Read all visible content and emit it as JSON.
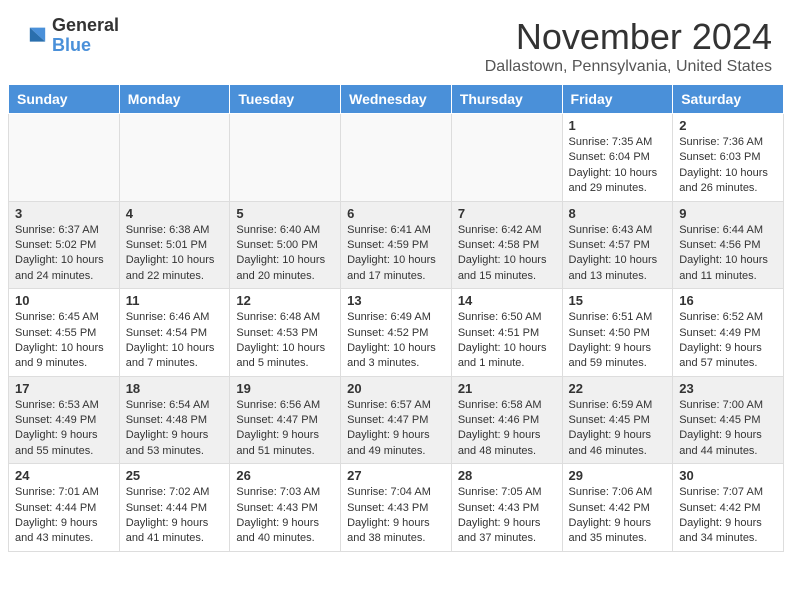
{
  "header": {
    "logo": {
      "general": "General",
      "blue": "Blue"
    },
    "title": "November 2024",
    "location": "Dallastown, Pennsylvania, United States"
  },
  "calendar": {
    "days_of_week": [
      "Sunday",
      "Monday",
      "Tuesday",
      "Wednesday",
      "Thursday",
      "Friday",
      "Saturday"
    ],
    "weeks": [
      [
        {
          "day": "",
          "info": ""
        },
        {
          "day": "",
          "info": ""
        },
        {
          "day": "",
          "info": ""
        },
        {
          "day": "",
          "info": ""
        },
        {
          "day": "",
          "info": ""
        },
        {
          "day": "1",
          "info": "Sunrise: 7:35 AM\nSunset: 6:04 PM\nDaylight: 10 hours and 29 minutes."
        },
        {
          "day": "2",
          "info": "Sunrise: 7:36 AM\nSunset: 6:03 PM\nDaylight: 10 hours and 26 minutes."
        }
      ],
      [
        {
          "day": "3",
          "info": "Sunrise: 6:37 AM\nSunset: 5:02 PM\nDaylight: 10 hours and 24 minutes."
        },
        {
          "day": "4",
          "info": "Sunrise: 6:38 AM\nSunset: 5:01 PM\nDaylight: 10 hours and 22 minutes."
        },
        {
          "day": "5",
          "info": "Sunrise: 6:40 AM\nSunset: 5:00 PM\nDaylight: 10 hours and 20 minutes."
        },
        {
          "day": "6",
          "info": "Sunrise: 6:41 AM\nSunset: 4:59 PM\nDaylight: 10 hours and 17 minutes."
        },
        {
          "day": "7",
          "info": "Sunrise: 6:42 AM\nSunset: 4:58 PM\nDaylight: 10 hours and 15 minutes."
        },
        {
          "day": "8",
          "info": "Sunrise: 6:43 AM\nSunset: 4:57 PM\nDaylight: 10 hours and 13 minutes."
        },
        {
          "day": "9",
          "info": "Sunrise: 6:44 AM\nSunset: 4:56 PM\nDaylight: 10 hours and 11 minutes."
        }
      ],
      [
        {
          "day": "10",
          "info": "Sunrise: 6:45 AM\nSunset: 4:55 PM\nDaylight: 10 hours and 9 minutes."
        },
        {
          "day": "11",
          "info": "Sunrise: 6:46 AM\nSunset: 4:54 PM\nDaylight: 10 hours and 7 minutes."
        },
        {
          "day": "12",
          "info": "Sunrise: 6:48 AM\nSunset: 4:53 PM\nDaylight: 10 hours and 5 minutes."
        },
        {
          "day": "13",
          "info": "Sunrise: 6:49 AM\nSunset: 4:52 PM\nDaylight: 10 hours and 3 minutes."
        },
        {
          "day": "14",
          "info": "Sunrise: 6:50 AM\nSunset: 4:51 PM\nDaylight: 10 hours and 1 minute."
        },
        {
          "day": "15",
          "info": "Sunrise: 6:51 AM\nSunset: 4:50 PM\nDaylight: 9 hours and 59 minutes."
        },
        {
          "day": "16",
          "info": "Sunrise: 6:52 AM\nSunset: 4:49 PM\nDaylight: 9 hours and 57 minutes."
        }
      ],
      [
        {
          "day": "17",
          "info": "Sunrise: 6:53 AM\nSunset: 4:49 PM\nDaylight: 9 hours and 55 minutes."
        },
        {
          "day": "18",
          "info": "Sunrise: 6:54 AM\nSunset: 4:48 PM\nDaylight: 9 hours and 53 minutes."
        },
        {
          "day": "19",
          "info": "Sunrise: 6:56 AM\nSunset: 4:47 PM\nDaylight: 9 hours and 51 minutes."
        },
        {
          "day": "20",
          "info": "Sunrise: 6:57 AM\nSunset: 4:47 PM\nDaylight: 9 hours and 49 minutes."
        },
        {
          "day": "21",
          "info": "Sunrise: 6:58 AM\nSunset: 4:46 PM\nDaylight: 9 hours and 48 minutes."
        },
        {
          "day": "22",
          "info": "Sunrise: 6:59 AM\nSunset: 4:45 PM\nDaylight: 9 hours and 46 minutes."
        },
        {
          "day": "23",
          "info": "Sunrise: 7:00 AM\nSunset: 4:45 PM\nDaylight: 9 hours and 44 minutes."
        }
      ],
      [
        {
          "day": "24",
          "info": "Sunrise: 7:01 AM\nSunset: 4:44 PM\nDaylight: 9 hours and 43 minutes."
        },
        {
          "day": "25",
          "info": "Sunrise: 7:02 AM\nSunset: 4:44 PM\nDaylight: 9 hours and 41 minutes."
        },
        {
          "day": "26",
          "info": "Sunrise: 7:03 AM\nSunset: 4:43 PM\nDaylight: 9 hours and 40 minutes."
        },
        {
          "day": "27",
          "info": "Sunrise: 7:04 AM\nSunset: 4:43 PM\nDaylight: 9 hours and 38 minutes."
        },
        {
          "day": "28",
          "info": "Sunrise: 7:05 AM\nSunset: 4:43 PM\nDaylight: 9 hours and 37 minutes."
        },
        {
          "day": "29",
          "info": "Sunrise: 7:06 AM\nSunset: 4:42 PM\nDaylight: 9 hours and 35 minutes."
        },
        {
          "day": "30",
          "info": "Sunrise: 7:07 AM\nSunset: 4:42 PM\nDaylight: 9 hours and 34 minutes."
        }
      ]
    ]
  }
}
